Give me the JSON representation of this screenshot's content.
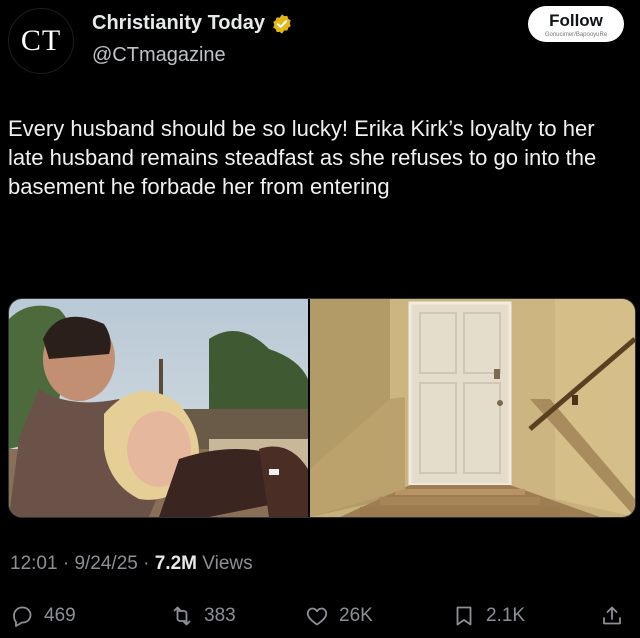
{
  "author": {
    "avatar_text": "CT",
    "display_name": "Christianity Today",
    "handle": "@CTmagazine",
    "verified_color": "#e2b719"
  },
  "follow_button": {
    "label": "Follow",
    "sublabel": "Gonucimer/BapooyuRe"
  },
  "tweet": {
    "text": "Every husband should be so lucky! Erika Kirk’s loyalty to her late husband remains steadfast as she refuses to go into the basement he forbade her from entering"
  },
  "meta": {
    "time": "12:01",
    "date": "9/24/25",
    "separator": "·",
    "views_count": "7.2M",
    "views_label": "Views"
  },
  "actions": {
    "replies": "469",
    "retweets": "383",
    "likes": "26K",
    "bookmarks": "2.1K"
  },
  "icons": {
    "reply": "reply-icon",
    "retweet": "retweet-icon",
    "like": "heart-icon",
    "bookmark": "bookmark-icon",
    "share": "share-icon",
    "verified": "verified-badge-icon"
  }
}
